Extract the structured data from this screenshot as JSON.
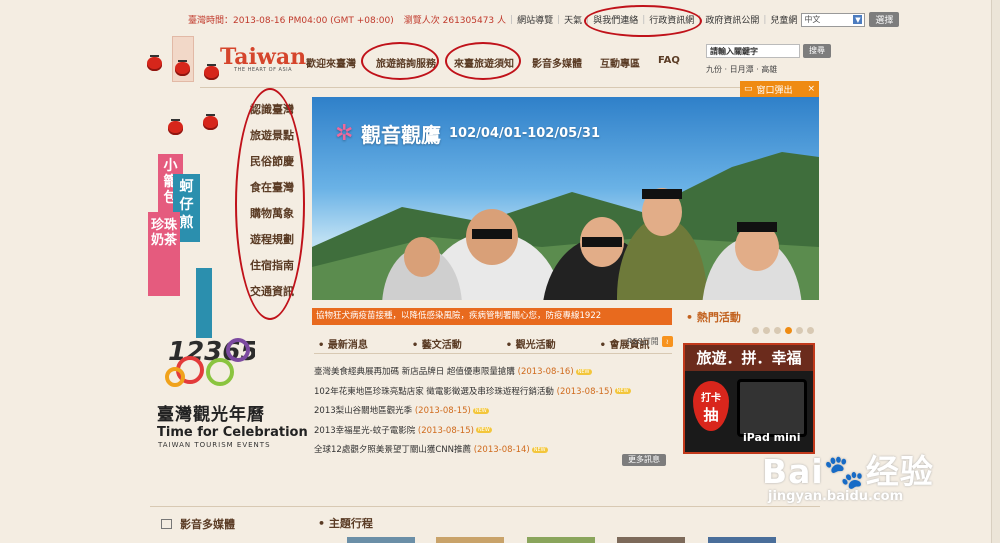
{
  "topbar": {
    "time_label": "臺灣時間：2013-08-16 PM04:00 (GMT +08:00)",
    "visitors_label": "瀏覽人次 261305473 人",
    "links": [
      "網站導覽",
      "天氣",
      "與我們連絡",
      "行政資訊網",
      "政府資訊公開",
      "兒童網"
    ],
    "language_value": "中文",
    "select_button": "選擇"
  },
  "logo": {
    "brand": "Taiwan",
    "tagline": "THE HEART OF ASIA"
  },
  "mainnav": [
    "歡迎來臺灣",
    "旅遊諮詢服務",
    "來臺旅遊須知",
    "影音多媒體",
    "互動專區",
    "FAQ"
  ],
  "search": {
    "placeholder": "請輸入關鍵字",
    "button": "搜尋",
    "hotwords": [
      "九份",
      "日月潭",
      "高雄"
    ]
  },
  "popup_button": {
    "label": "窗口彈出",
    "close": "×"
  },
  "leftmenu": [
    "認識臺灣",
    "旅遊景點",
    "民俗節慶",
    "食在臺灣",
    "購物萬象",
    "遊程規劃",
    "住宿指南",
    "交通資訊"
  ],
  "side_signs": {
    "sign1": "小籠包",
    "sign2": "蚵仔煎",
    "sign3": "珍珠奶茶"
  },
  "banner": {
    "title": "觀音觀鷹",
    "dates": "102/04/01-102/05/31"
  },
  "announcement": "協物狂犬病疫苗接種，以降低感染風險，疾病管制署關心您，防疫專線1922",
  "news": {
    "tabs": [
      "最新消息",
      "藝文活動",
      "觀光活動",
      "會展資訊"
    ],
    "rss_label": "RSS訂閱",
    "items": [
      {
        "title": "臺灣美食經典展再加碼 新店品牌日 超值優惠限量搶購",
        "date": "(2013-08-16)"
      },
      {
        "title": "102年花東地區珍珠亮點店家 徵電影徵選及串珍珠遊程行銷活動",
        "date": "(2013-08-15)"
      },
      {
        "title": "2013梨山谷關地區觀光季",
        "date": "(2013-08-15)"
      },
      {
        "title": "2013幸福星光-蚊子電影院",
        "date": "(2013-08-15)"
      },
      {
        "title": "全球12處觀夕照美景望丁關山獲CNN推薦",
        "date": "(2013-08-14)"
      }
    ],
    "new_badge": "NEW",
    "more_button": "更多訊息"
  },
  "hot": {
    "title": "熱門活動",
    "ad_headline": "旅遊．拼．幸福",
    "ad_checkin": "打卡",
    "ad_draw": "抽",
    "ad_prize": "iPad mini"
  },
  "celebration": {
    "numbers": "123654",
    "title": "臺灣觀光年曆",
    "en": "Time for Celebration",
    "sub": "TAIWAN TOURISM EVENTS"
  },
  "bottom": {
    "media_title": "影音多媒體",
    "theme_title": "主題行程"
  },
  "watermark": {
    "brand": "Bai🐾经验",
    "url": "jingyan.baidu.com"
  }
}
